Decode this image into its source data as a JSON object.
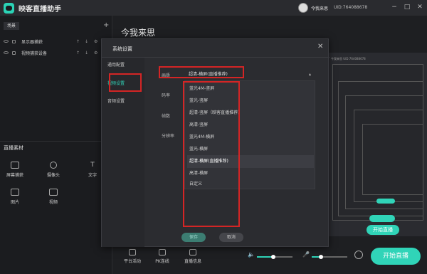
{
  "app": {
    "title": "映客直播助手"
  },
  "user": {
    "name": "今我来思",
    "uid": "UID:764088678"
  },
  "window_controls": [
    "−",
    "□",
    "✕"
  ],
  "scene": {
    "tab": "场景",
    "add": "+"
  },
  "sources": [
    {
      "label": "显示器捕获"
    },
    {
      "label": "视频捕获设备"
    }
  ],
  "materials": {
    "heading": "直播素材",
    "items": [
      {
        "label": "屏幕捕获",
        "icon": "screen-capture-icon"
      },
      {
        "label": "摄像头",
        "icon": "camera-icon"
      },
      {
        "label": "文字",
        "icon": "text-icon"
      },
      {
        "label": "图片",
        "icon": "image-icon"
      },
      {
        "label": "视频",
        "icon": "video-icon"
      }
    ]
  },
  "main": {
    "title": "今我来思",
    "preview_uid": "今我来思   UID:764088678",
    "bottom": [
      {
        "label": "平台活动",
        "icon": "flag-icon"
      },
      {
        "label": "PK连线",
        "icon": "pk-icon"
      },
      {
        "label": "直播信息",
        "icon": "info-icon"
      }
    ],
    "start_button": "开始直播",
    "preview_start_button": "开始直播",
    "volume_level": 0.45,
    "mic_level": 0.25
  },
  "dialog": {
    "title": "系统设置",
    "close": "✕",
    "menu": [
      "通用配置",
      "视频设置",
      "音频设置"
    ],
    "active_menu": 1,
    "rows": {
      "quality": "画质",
      "bitrate": "码率",
      "fps": "帧数",
      "resolution": "分辨率"
    },
    "selected_quality": "超清-横屏(直播推荐)",
    "quality_options": [
      "蓝光4M-竖屏",
      "蓝光-竖屏",
      "超清-竖屏（映客直播推荐）",
      "高清-竖屏",
      "蓝光4M-横屏",
      "蓝光-横屏",
      "超清-横屏(直播推荐)",
      "高清-横屏",
      "自定义"
    ],
    "save": "保存",
    "cancel": "取消"
  },
  "colors": {
    "accent": "#30d4b8",
    "highlight_box": "#d42525"
  }
}
